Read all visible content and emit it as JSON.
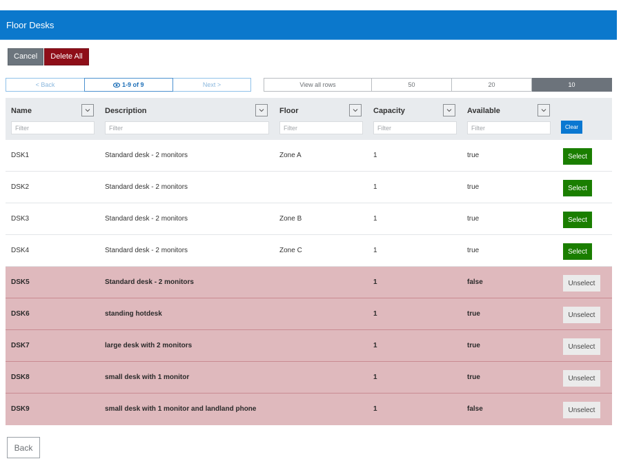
{
  "header": {
    "title": "Floor Desks"
  },
  "actions": {
    "cancel_label": "Cancel",
    "delete_all_label": "Delete All"
  },
  "colors": {
    "header_bg": "#0b78cc",
    "delete_bg": "#8e0e18",
    "select_bg": "#1a7e00",
    "selected_row_bg": "#dfb9bd",
    "clear_bg": "#0a78d1"
  },
  "pager": {
    "back_label": "< Back",
    "info_icon": "eye-icon",
    "info_label": "1-9 of 9",
    "next_label": "Next >"
  },
  "rows_per_page": {
    "options": [
      "View all rows",
      "50",
      "20",
      "10"
    ],
    "selected": "10"
  },
  "grid": {
    "columns": [
      {
        "label": "Name",
        "filter_placeholder": "Filter"
      },
      {
        "label": "Description",
        "filter_placeholder": "Filter"
      },
      {
        "label": "Floor",
        "filter_placeholder": "Filter"
      },
      {
        "label": "Capacity",
        "filter_placeholder": "Filter"
      },
      {
        "label": "Available",
        "filter_placeholder": "Filter"
      }
    ],
    "clear_label": "Clear",
    "select_label": "Select",
    "unselect_label": "Unselect",
    "rows": [
      {
        "name": "DSK1",
        "description": "Standard desk - 2 monitors",
        "floor": "Zone A",
        "capacity": "1",
        "available": "true",
        "selected": false
      },
      {
        "name": "DSK2",
        "description": "Standard desk - 2 monitors",
        "floor": "",
        "capacity": "1",
        "available": "true",
        "selected": false
      },
      {
        "name": "DSK3",
        "description": "Standard desk - 2 monitors",
        "floor": "Zone B",
        "capacity": "1",
        "available": "true",
        "selected": false
      },
      {
        "name": "DSK4",
        "description": "Standard desk - 2 monitors",
        "floor": "Zone C",
        "capacity": "1",
        "available": "true",
        "selected": false
      },
      {
        "name": "DSK5",
        "description": "Standard desk - 2 monitors",
        "floor": "",
        "capacity": "1",
        "available": "false",
        "selected": true
      },
      {
        "name": "DSK6",
        "description": "standing hotdesk",
        "floor": "",
        "capacity": "1",
        "available": "true",
        "selected": true
      },
      {
        "name": "DSK7",
        "description": "large desk with 2 monitors",
        "floor": "",
        "capacity": "1",
        "available": "true",
        "selected": true
      },
      {
        "name": "DSK8",
        "description": "small desk with 1 monitor",
        "floor": "",
        "capacity": "1",
        "available": "true",
        "selected": true
      },
      {
        "name": "DSK9",
        "description": "small desk with 1 monitor and landland phone",
        "floor": "",
        "capacity": "1",
        "available": "false",
        "selected": true
      }
    ]
  },
  "footer": {
    "back_label": "Back"
  }
}
